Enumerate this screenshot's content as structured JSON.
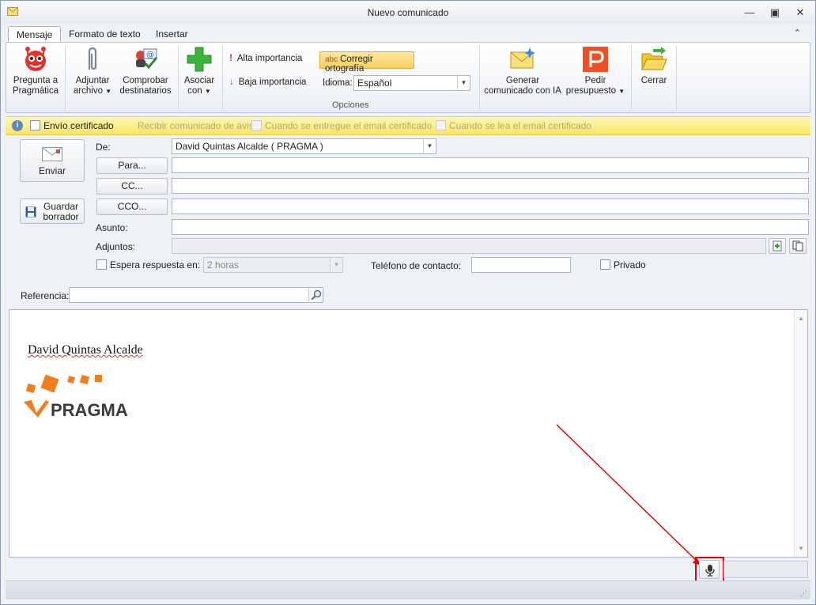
{
  "window": {
    "title": "Nuevo comunicado"
  },
  "tabs": [
    {
      "label": "Mensaje"
    },
    {
      "label": "Formato de texto"
    },
    {
      "label": "Insertar"
    }
  ],
  "ribbon": {
    "ask_label": "Pregunta a Pragmática",
    "ask_line1": "Pregunta a",
    "ask_line2": "Pragmática",
    "attach_line1": "Adjuntar",
    "attach_line2": "archivo",
    "check_line1": "Comprobar",
    "check_line2": "destinatarios",
    "associate_line1": "Asociar",
    "associate_line2": "con",
    "high_importance": "Alta importancia",
    "low_importance": "Baja importancia",
    "spellcheck": "Corregir ortografía",
    "language_label": "Idioma:",
    "language_value": "Español",
    "group_options": "Opciones",
    "generate_line1": "Generar",
    "generate_line2": "comunicado con IA",
    "quote_line1": "Pedir",
    "quote_line2": "presupuesto",
    "close": "Cerrar"
  },
  "infobar": {
    "certified": "Envío certificado",
    "receive_notice": "Recibir comunicado de aviso:",
    "when_delivered": "Cuando se entregue el email certificado",
    "when_read": "Cuando se lea el email certificado"
  },
  "form": {
    "send": "Enviar",
    "save_line1": "Guardar",
    "save_line2": "borrador",
    "from_label": "De:",
    "from_value": "David Quintas Alcalde ( PRAGMA )",
    "to_button": "Para...",
    "cc_button": "CC...",
    "bcc_button": "CCO...",
    "subject_label": "Asunto:",
    "attachments_label": "Adjuntos:",
    "await_reply": "Espera respuesta en:",
    "await_value": "2 horas",
    "phone_label": "Teléfono de contacto:",
    "private": "Privado",
    "reference_label": "Referencia:"
  },
  "body": {
    "signature_name": "David Quintas Alcalde",
    "logo_text": "PRAGMA"
  },
  "colors": {
    "accent_orange": "#f07d1e",
    "infobar_yellow": "#fbe566",
    "highlight_red": "#e00000"
  }
}
